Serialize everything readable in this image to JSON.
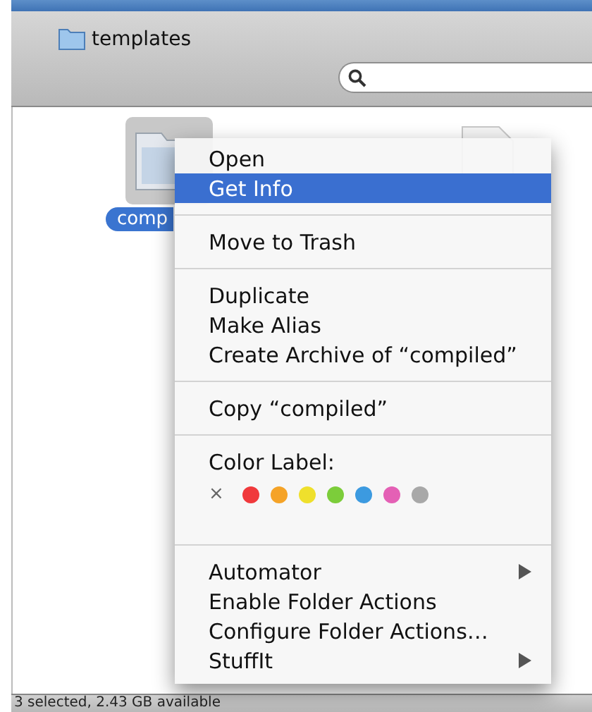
{
  "window": {
    "title": "templates"
  },
  "files": [
    {
      "name": "comp",
      "kind": "folder",
      "selected": true
    },
    {
      "kind": "document",
      "selected": false
    }
  ],
  "context_menu": {
    "items": [
      {
        "kind": "item",
        "label": "Open",
        "selected": false,
        "submenu": false
      },
      {
        "kind": "item",
        "label": "Get Info",
        "selected": true,
        "submenu": false
      },
      {
        "kind": "separator"
      },
      {
        "kind": "item",
        "label": "Move to Trash",
        "selected": false,
        "submenu": false
      },
      {
        "kind": "separator"
      },
      {
        "kind": "item",
        "label": "Duplicate",
        "selected": false,
        "submenu": false
      },
      {
        "kind": "item",
        "label": "Make Alias",
        "selected": false,
        "submenu": false
      },
      {
        "kind": "item",
        "label": "Create Archive of “compiled”",
        "selected": false,
        "submenu": false
      },
      {
        "kind": "separator"
      },
      {
        "kind": "item",
        "label": "Copy “compiled”",
        "selected": false,
        "submenu": false
      },
      {
        "kind": "separator"
      },
      {
        "kind": "color_label",
        "label": "Color Label:",
        "none": "×",
        "colors": [
          {
            "color": "#f0393c"
          },
          {
            "color": "#f5a327"
          },
          {
            "color": "#efe02c"
          },
          {
            "color": "#7ccd3a"
          },
          {
            "color": "#3c9ae0"
          },
          {
            "color": "#e460b5"
          },
          {
            "color": "#a8a8a8"
          }
        ]
      },
      {
        "kind": "separator"
      },
      {
        "kind": "item",
        "label": "Automator",
        "selected": false,
        "submenu": true
      },
      {
        "kind": "item",
        "label": "Enable Folder Actions",
        "selected": false,
        "submenu": false
      },
      {
        "kind": "item",
        "label": "Configure Folder Actions…",
        "selected": false,
        "submenu": false
      },
      {
        "kind": "item",
        "label": "StuffIt",
        "selected": false,
        "submenu": true
      }
    ]
  },
  "status_bar": "3 selected, 2.43 GB available"
}
